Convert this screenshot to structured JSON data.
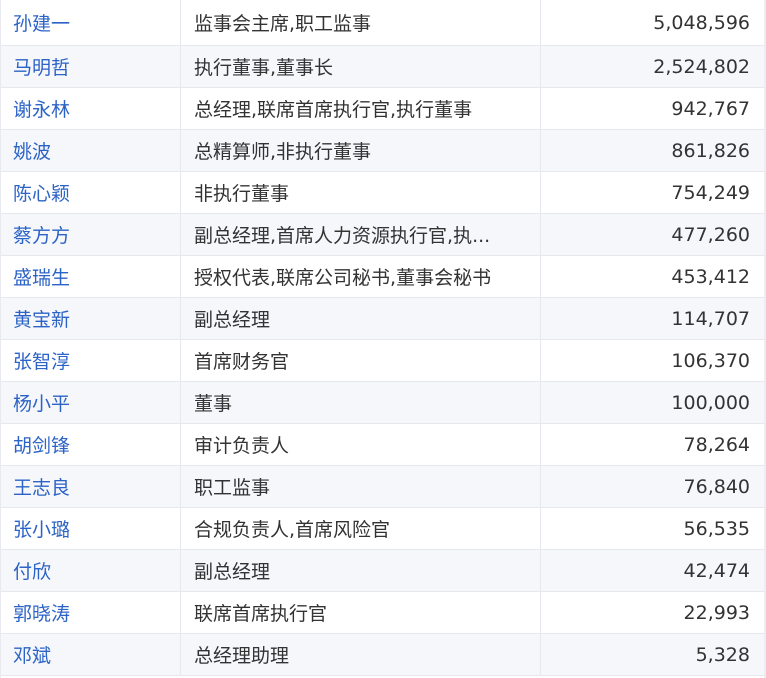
{
  "rows": [
    {
      "name": "孙建一",
      "title": "监事会主席,职工监事",
      "amount": "5,048,596"
    },
    {
      "name": "马明哲",
      "title": "执行董事,董事长",
      "amount": "2,524,802"
    },
    {
      "name": "谢永林",
      "title": "总经理,联席首席执行官,执行董事",
      "amount": "942,767"
    },
    {
      "name": "姚波",
      "title": "总精算师,非执行董事",
      "amount": "861,826"
    },
    {
      "name": "陈心颖",
      "title": "非执行董事",
      "amount": "754,249"
    },
    {
      "name": "蔡方方",
      "title": "副总经理,首席人力资源执行官,执...",
      "amount": "477,260"
    },
    {
      "name": "盛瑞生",
      "title": "授权代表,联席公司秘书,董事会秘书",
      "amount": "453,412"
    },
    {
      "name": "黄宝新",
      "title": "副总经理",
      "amount": "114,707"
    },
    {
      "name": "张智淳",
      "title": "首席财务官",
      "amount": "106,370"
    },
    {
      "name": "杨小平",
      "title": "董事",
      "amount": "100,000"
    },
    {
      "name": "胡剑锋",
      "title": "审计负责人",
      "amount": "78,264"
    },
    {
      "name": "王志良",
      "title": "职工监事",
      "amount": "76,840"
    },
    {
      "name": "张小璐",
      "title": "合规负责人,首席风险官",
      "amount": "56,535"
    },
    {
      "name": "付欣",
      "title": "副总经理",
      "amount": "42,474"
    },
    {
      "name": "郭晓涛",
      "title": "联席首席执行官",
      "amount": "22,993"
    },
    {
      "name": "邓斌",
      "title": "总经理助理",
      "amount": "5,328"
    }
  ]
}
